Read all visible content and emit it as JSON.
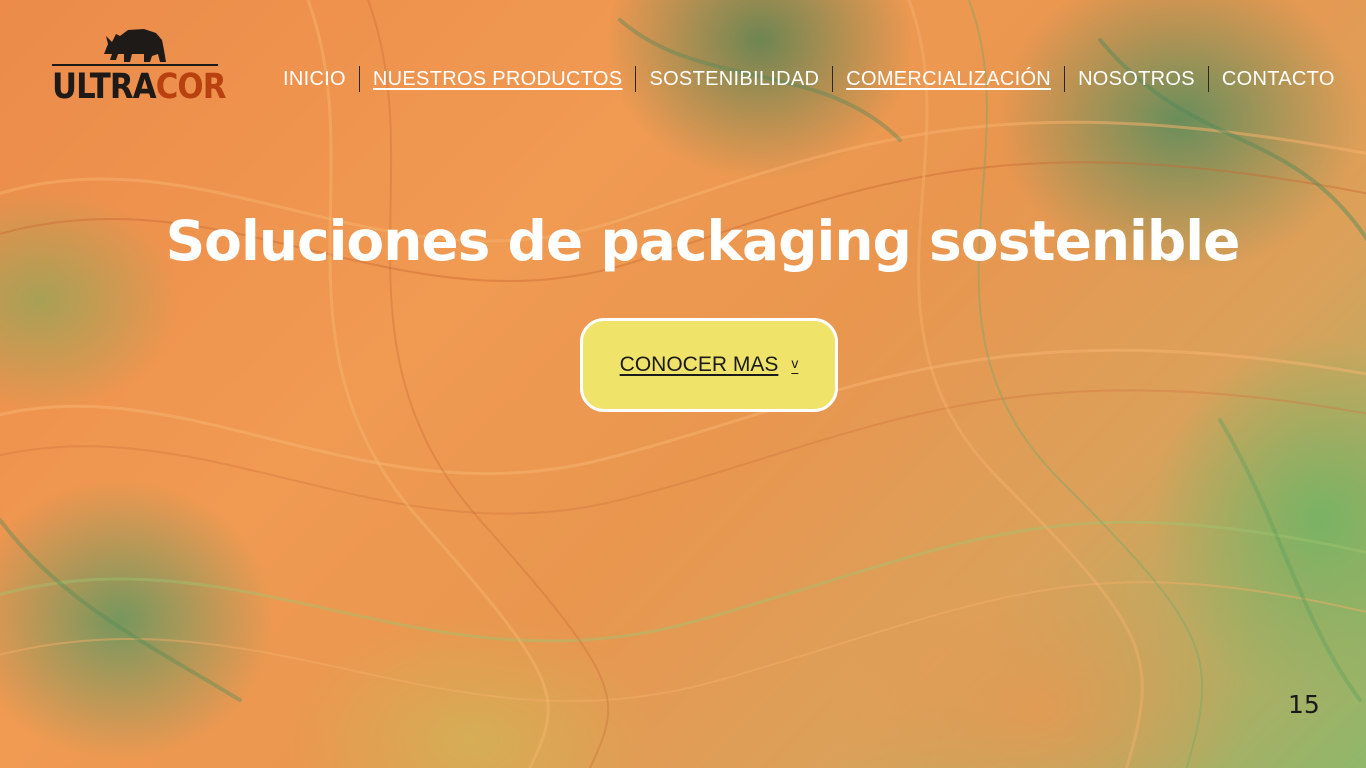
{
  "brand": {
    "logo_text_dark": "ULTRA",
    "logo_text_accent": "COR",
    "dark_color": "#1e1a17",
    "accent_color": "#b8410f",
    "logo_icon": "rhino-icon"
  },
  "nav": {
    "items": [
      {
        "label": "INICIO"
      },
      {
        "label": "NUESTROS PRODUCTOS"
      },
      {
        "label": "SOSTENIBILIDAD"
      },
      {
        "label": "COMERCIALIZACIÓN"
      },
      {
        "label": "NOSOTROS"
      },
      {
        "label": "CONTACTO"
      }
    ]
  },
  "hero": {
    "title": "Soluciones de packaging sostenible",
    "cta_label": "CONOCER MAS",
    "cta_icon": "chevron-down-icon",
    "cta_chevron": "v",
    "cta_color": "#efe36a"
  },
  "page_counter": "15"
}
